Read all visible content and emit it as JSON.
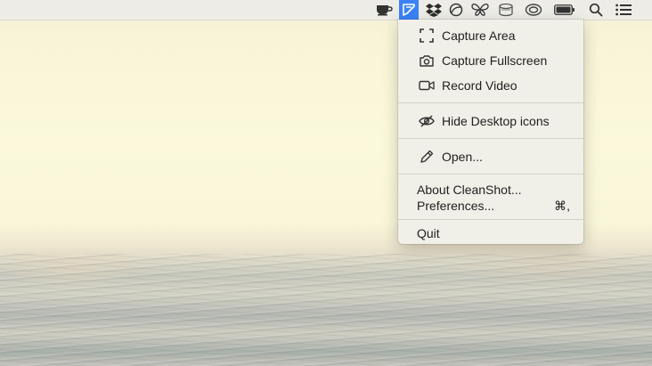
{
  "menubar": {
    "icons": [
      {
        "name": "coffee-cup-icon"
      },
      {
        "name": "cleanshot-icon",
        "active": true
      },
      {
        "name": "dropbox-icon"
      },
      {
        "name": "sync-ball-icon"
      },
      {
        "name": "butterfly-icon"
      },
      {
        "name": "jar-icon"
      },
      {
        "name": "cloud-swirl-icon"
      },
      {
        "name": "battery-icon"
      },
      {
        "name": "search-icon"
      },
      {
        "name": "list-icon"
      }
    ],
    "active_color": "#3b82f6"
  },
  "menu": {
    "capture_area": "Capture Area",
    "capture_fullscreen": "Capture Fullscreen",
    "record_video": "Record Video",
    "hide_desktop_icons": "Hide Desktop icons",
    "open": "Open...",
    "about": "About CleanShot...",
    "preferences": "Preferences...",
    "preferences_shortcut": "⌘,",
    "quit": "Quit"
  }
}
